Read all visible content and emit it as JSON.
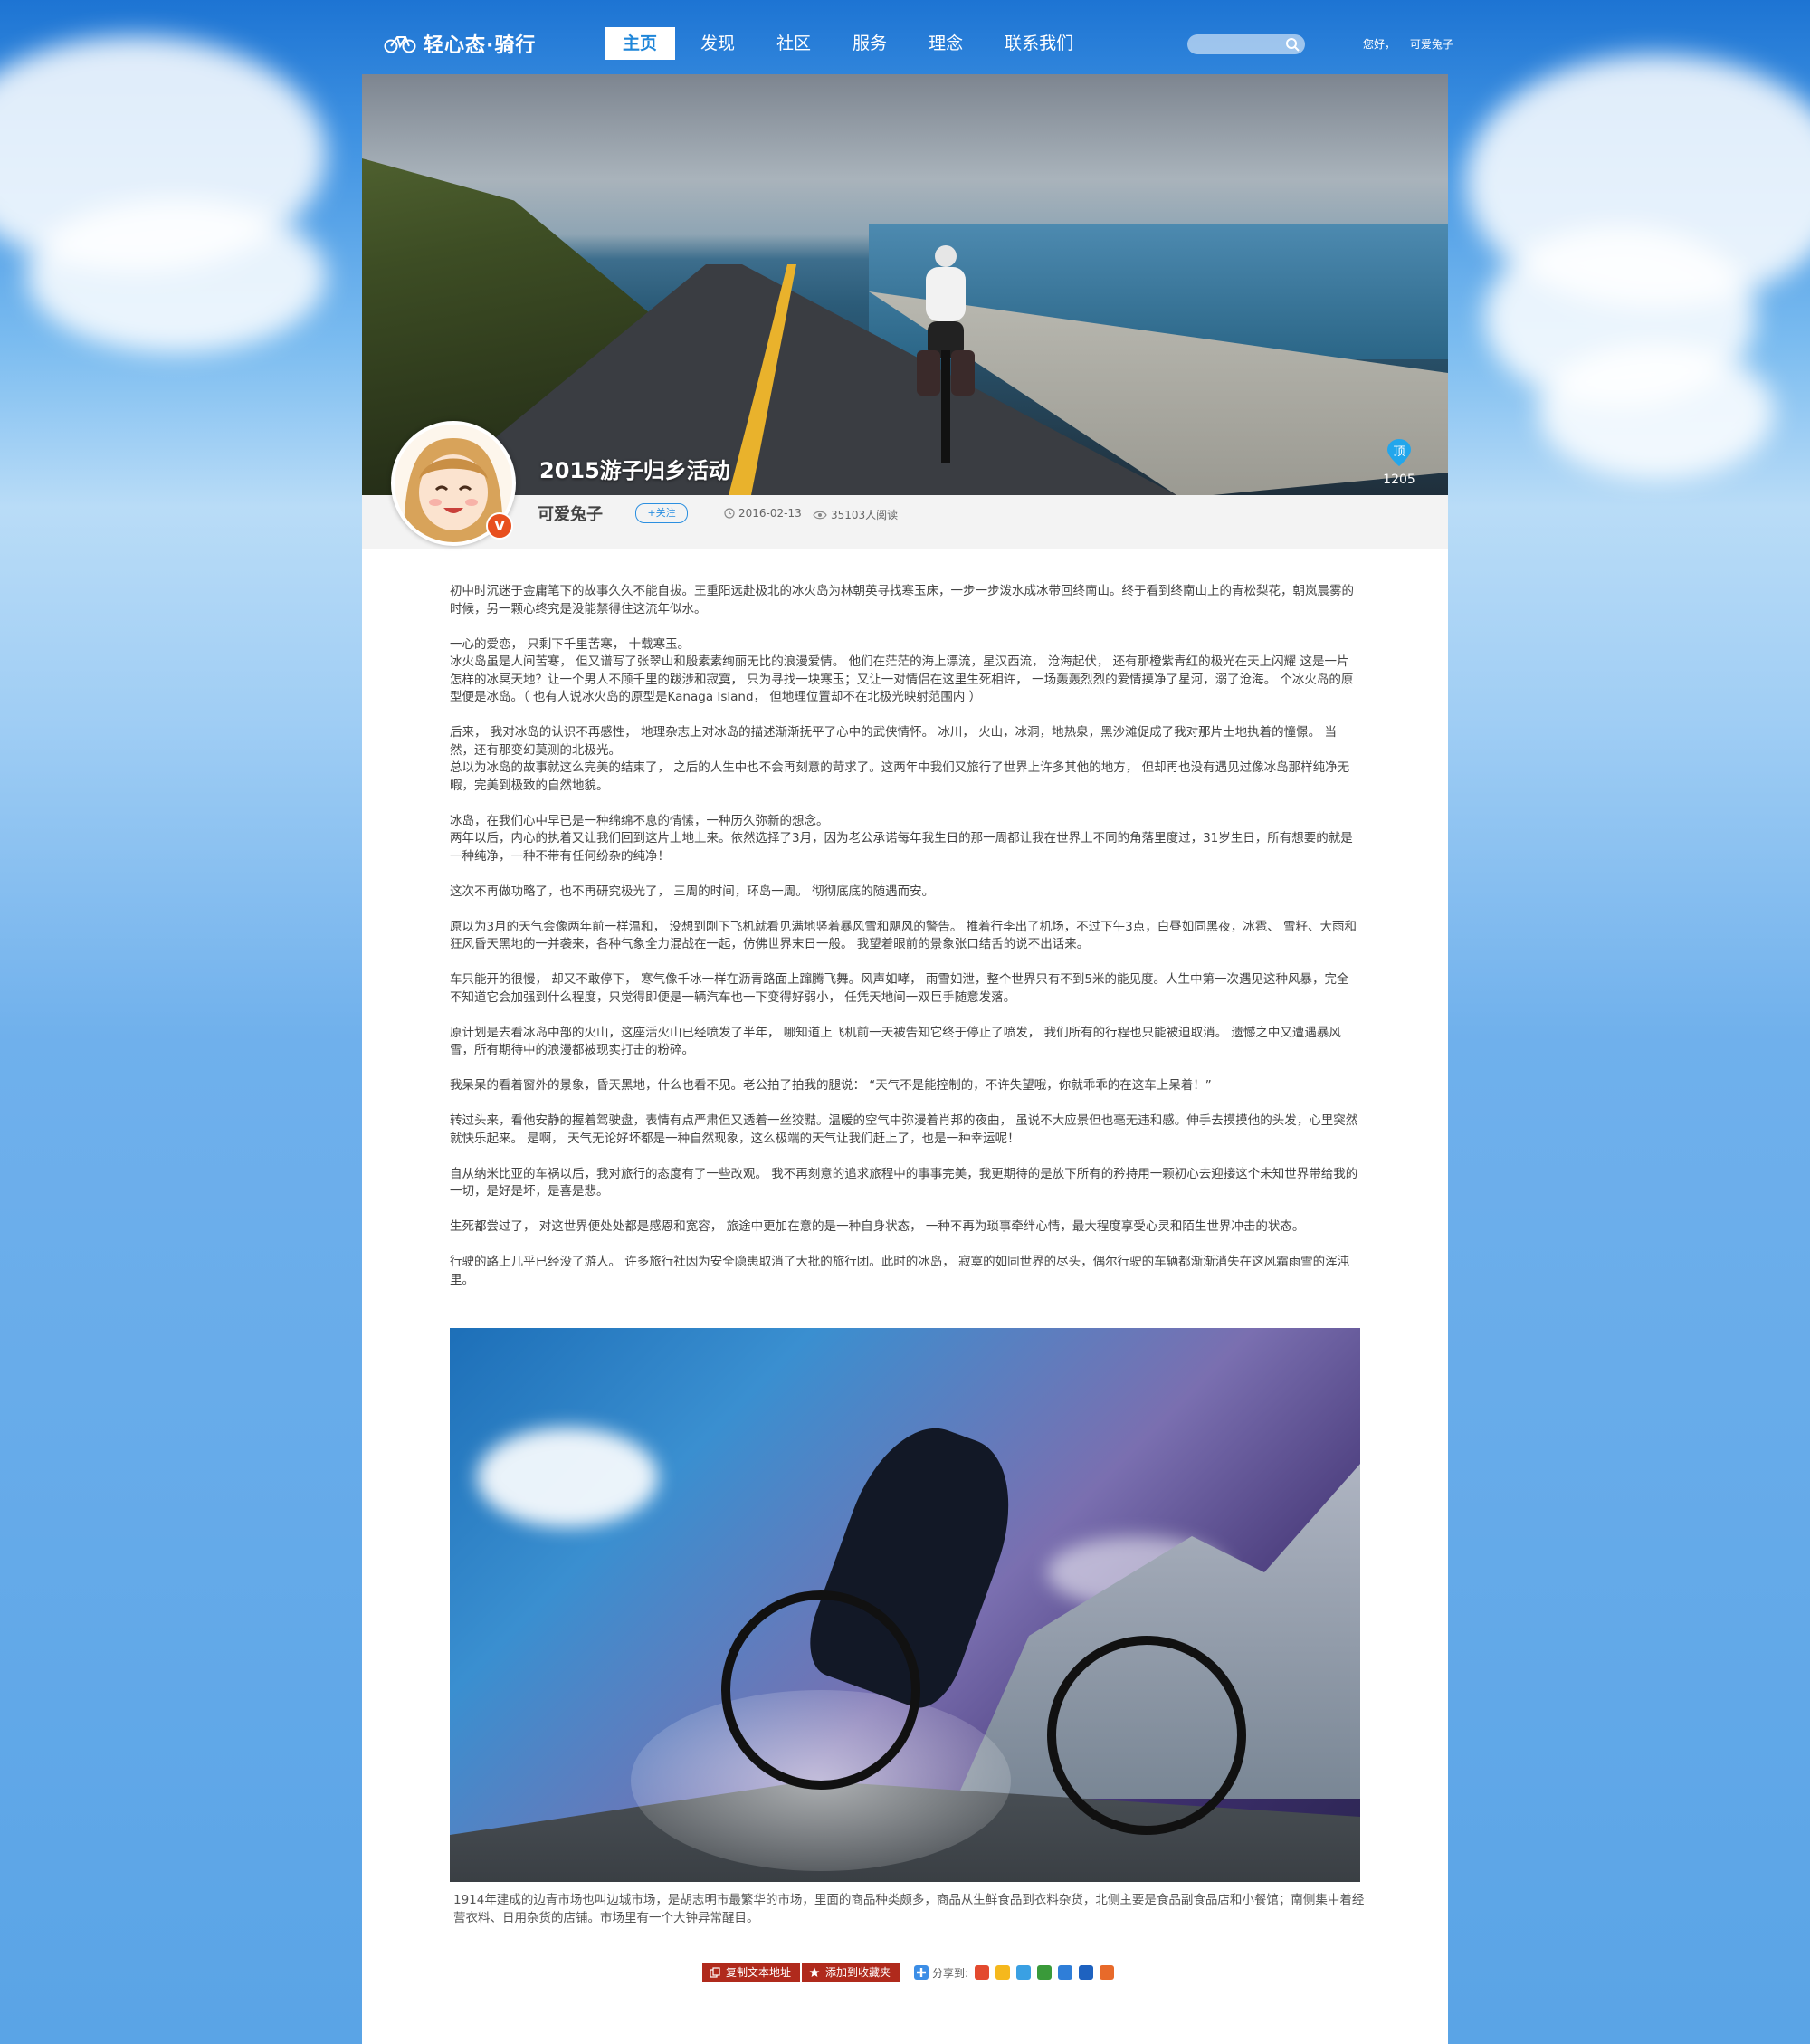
{
  "header": {
    "logo_text": "轻心态·骑行",
    "nav": [
      "主页",
      "发现",
      "社区",
      "服务",
      "理念",
      "联系我们"
    ],
    "active_nav": "主页",
    "search_placeholder": "",
    "greeting": "您好，",
    "username": "可爱兔子"
  },
  "post": {
    "title": "2015游子归乡活动",
    "likes_label": "顶",
    "likes": "1205",
    "author": "可爱兔子",
    "verified_badge": "V",
    "follow_label": "+关注",
    "date": "2016-02-13",
    "reads": "35103人阅读"
  },
  "article": {
    "paragraphs": [
      "初中时沉迷于金庸笔下的故事久久不能自拔。王重阳远赴极北的冰火岛为林朝英寻找寒玉床，一步一步泼水成冰带回终南山。终于看到终南山上的青松梨花，朝岚晨雾的时候，另一颗心终究是没能禁得住这流年似水。",
      "一心的爱恋， 只剩下千里苦寒， 十载寒玉。\n冰火岛虽是人间苦寒， 但又谱写了张翠山和殷素素绚丽无比的浪漫爱情。 他们在茫茫的海上漂流，星汉西流， 沧海起伏， 还有那橙紫青红的极光在天上闪耀 这是一片怎样的冰冥天地？让一个男人不顾千里的跋涉和寂寞， 只为寻找一块寒玉；又让一对情侣在这里生死相许， 一场轰轰烈烈的爱情摸净了星河，溺了沧海。 个冰火岛的原型便是冰岛。（ 也有人说冰火岛的原型是Kanaga Island， 但地理位置却不在北极光映射范围内 ）",
      "后来， 我对冰岛的认识不再感性， 地理杂志上对冰岛的描述渐渐抚平了心中的武侠情怀。 冰川， 火山，冰洞，地热泉，黑沙滩促成了我对那片土地执着的憧憬。 当然，还有那变幻莫测的北极光。\n总以为冰岛的故事就这么完美的结束了， 之后的人生中也不会再刻意的苛求了。这两年中我们又旅行了世界上许多其他的地方， 但却再也没有遇见过像冰岛那样纯净无暇，完美到极致的自然地貌。",
      "冰岛，在我们心中早已是一种绵绵不息的情愫，一种历久弥新的想念。\n两年以后，内心的执着又让我们回到这片土地上来。依然选择了3月，因为老公承诺每年我生日的那一周都让我在世界上不同的角落里度过，31岁生日，所有想要的就是一种纯净，一种不带有任何纷杂的纯净！",
      "这次不再做功略了，也不再研究极光了， 三周的时间，环岛一周。 彻彻底底的随遇而安。",
      "原以为3月的天气会像两年前一样温和， 没想到刚下飞机就看见满地竖着暴风雪和飓风的警告。 推着行李出了机场，不过下午3点，白昼如同黑夜，冰雹、 雪籽、大雨和狂风昏天黑地的一并袭来，各种气象全力混战在一起，仿佛世界末日一般。 我望着眼前的景象张口结舌的说不出话来。",
      "车只能开的很慢， 却又不敢停下， 寒气像千冰一样在沥青路面上蹿腾飞舞。风声如哮， 雨雪如泄，整个世界只有不到5米的能见度。人生中第一次遇见这种风暴，完全不知道它会加强到什么程度，只觉得即便是一辆汽车也一下变得好弱小， 任凭天地间一双巨手随意发落。",
      "原计划是去看冰岛中部的火山，这座活火山已经喷发了半年， 哪知道上飞机前一天被告知它终于停止了喷发， 我们所有的行程也只能被迫取消。 遗憾之中又遭遇暴风雪，所有期待中的浪漫都被现实打击的粉碎。",
      "我呆呆的看着窗外的景象，昏天黑地，什么也看不见。老公拍了拍我的腿说： “天气不是能控制的，不许失望哦，你就乖乖的在这车上呆着！”",
      "转过头来，看他安静的握着驾驶盘，表情有点严肃但又透着一丝狡黠。温暖的空气中弥漫着肖邦的夜曲， 虽说不大应景但也毫无违和感。伸手去摸摸他的头发，心里突然就快乐起来。 是啊， 天气无论好坏都是一种自然现象，这么极端的天气让我们赶上了，也是一种幸运呢！",
      "自从纳米比亚的车祸以后，我对旅行的态度有了一些改观。 我不再刻意的追求旅程中的事事完美，我更期待的是放下所有的矜持用一颗初心去迎接这个未知世界带给我的一切，是好是坏，是喜是悲。",
      "生死都尝过了， 对这世界便处处都是感恩和宽容， 旅途中更加在意的是一种自身状态， 一种不再为琐事牵绊心情，最大程度享受心灵和陌生世界冲击的状态。",
      "行驶的路上几乎已经没了游人。 许多旅行社因为安全隐患取消了大批的旅行团。此时的冰岛， 寂寞的如同世界的尽头，偶尔行驶的车辆都渐渐消失在这风霜雨雪的浑沌里。"
    ],
    "photo_caption": "1914年建成的边青市场也叫边城市场，是胡志明市最繁华的市场，里面的商品种类颇多，商品从生鲜食品到衣料杂货，北侧主要是食品副食品店和小餐馆；南侧集中着经营衣料、日用杂货的店铺。市场里有一个大钟异常醒目。"
  },
  "actions": {
    "copy_label": "复制文本地址",
    "favorite_label": "添加到收藏夹",
    "share_label": "分享到:"
  },
  "share_icons": [
    "weibo-icon",
    "qzone-icon",
    "tencent-weibo-icon",
    "douban-icon",
    "renren-icon",
    "renren-people-icon",
    "more-share-icon"
  ],
  "colors": {
    "accent": "#2b8fe0",
    "action_red": "#b02a1c",
    "badge_red": "#e8501f"
  }
}
